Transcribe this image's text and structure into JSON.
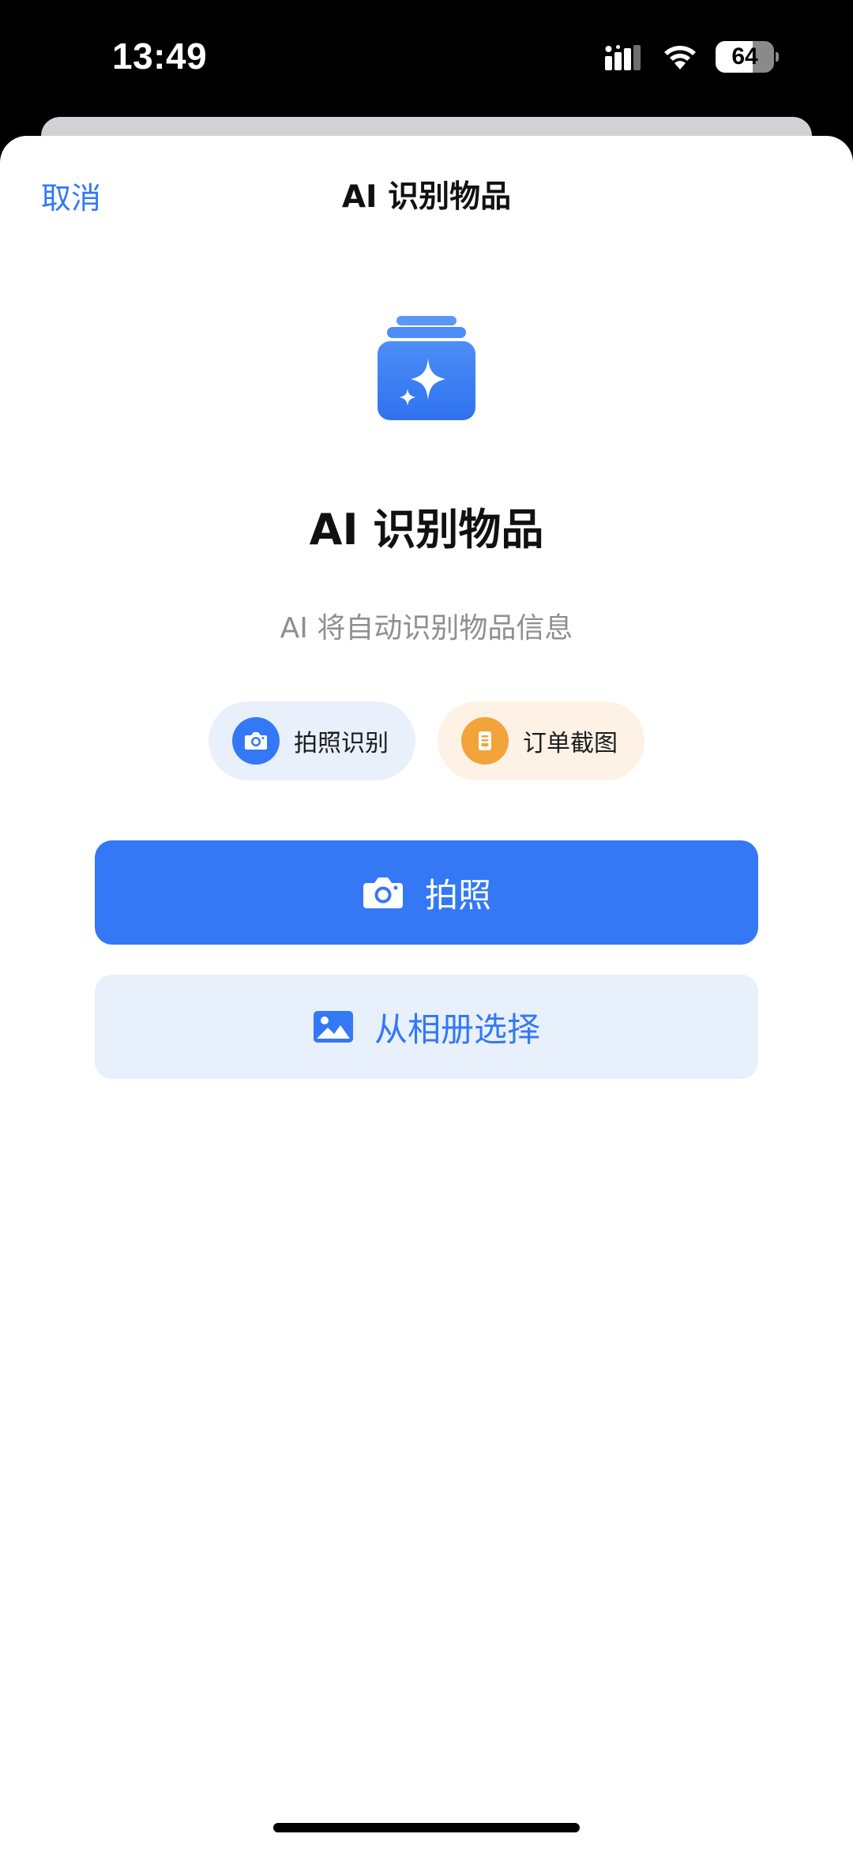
{
  "status_bar": {
    "time": "13:49",
    "battery_level": "64",
    "icons": [
      "signal-icon",
      "wifi-icon",
      "battery-icon"
    ]
  },
  "nav": {
    "cancel_label": "取消",
    "title": "AI 识别物品"
  },
  "hero": {
    "icon": "sparkle-stack-icon",
    "title": "AI 识别物品",
    "subtitle": "AI 将自动识别物品信息"
  },
  "chips": [
    {
      "label": "拍照识别",
      "icon": "camera-icon",
      "color": "#3478f6"
    },
    {
      "label": "订单截图",
      "icon": "document-icon",
      "color": "#f2a33a"
    }
  ],
  "actions": {
    "take_photo_label": "拍照",
    "take_photo_icon": "camera-icon",
    "album_label": "从相册选择",
    "album_icon": "photo-icon"
  },
  "colors": {
    "accent": "#3478f6",
    "accent_light": "#e8f0fc",
    "warning": "#f2a33a",
    "warning_light": "#fdf2e5",
    "subtitle": "#8e8e93"
  }
}
